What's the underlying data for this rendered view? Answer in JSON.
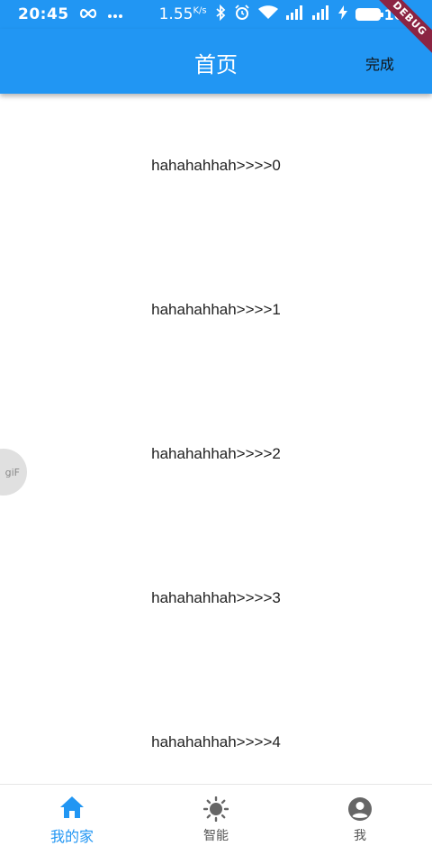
{
  "status_bar": {
    "time": "20:45",
    "speed": "1.55",
    "speed_unit": "K/s",
    "battery": "100",
    "debug_label": "DEBUG"
  },
  "app_bar": {
    "title": "首页",
    "action_label": "完成"
  },
  "list": {
    "items": [
      "hahahahhah>>>>0",
      "hahahahhah>>>>1",
      "hahahahhah>>>>2",
      "hahahahhah>>>>3",
      "hahahahhah>>>>4"
    ]
  },
  "floating": {
    "gif_label": "giF"
  },
  "bottom_nav": {
    "items": [
      {
        "label": "我的家",
        "icon": "home-icon",
        "active": true
      },
      {
        "label": "智能",
        "icon": "sun-icon",
        "active": false
      },
      {
        "label": "我",
        "icon": "account-circle-icon",
        "active": false
      }
    ]
  },
  "colors": {
    "primary": "#2196f3",
    "debug_banner": "#8b2443"
  }
}
